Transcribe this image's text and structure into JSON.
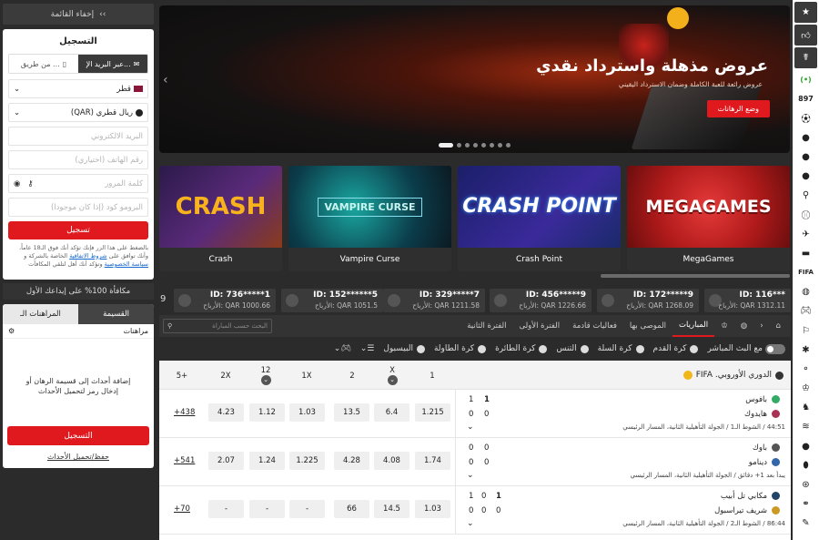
{
  "sidebar": {
    "collapse_label": "إخفاء القائمة",
    "register": {
      "title": "التسجيل",
      "method_email": "عبر البريد الإ...",
      "method_phone": "من طريق ...",
      "country": "قطر",
      "currency": "ريال قطري (QAR)",
      "email_placeholder": "البريد الالكتروني",
      "phone_placeholder": "رقم الهاتف (اختياري)",
      "password_placeholder": "كلمة المرور",
      "promo_placeholder": "البرومو كود (إذا كان موجودا)",
      "submit": "تسجيل",
      "terms_text": "بالضغط على هذا الزر فإنك تؤكد أنك فوق الـ18 عاماً، وأنك توافق على",
      "terms_link1": "شروط الاتفاقية",
      "terms_mid": "الخاصة بالشركة و",
      "terms_link2": "سياسة الخصوصية",
      "terms_end": "وتؤكد أنك أهل لتلقي المكافآت"
    },
    "bonus_text": "مكافأة 100% على إيداعك الأول",
    "betslip": {
      "tab_slip": "القسيمة",
      "tab_bets": "المراهنات الـ",
      "sub_title": "مراهنات",
      "empty_msg": "إضافة أحداث إلى قسيمة الرهان أو إدخال رمز لتحميل الأحداث",
      "register_btn": "التسجيل",
      "save_link": "حفظ/تحميل الأحداث"
    }
  },
  "banner": {
    "title": "عروض مذهلة واسترداد نقدي",
    "subtitle": "عروض رائعة للعبة الكاملة وضمان الاسترداد اليقيني",
    "button": "وضع الرهانات"
  },
  "games": [
    {
      "name": "Crash",
      "art": "CRASH"
    },
    {
      "name": "Vampire Curse",
      "art": "VAMPIRE CURSE"
    },
    {
      "name": "Crash Point",
      "art": "CRASH POINT"
    },
    {
      "name": "MegaGames",
      "art": "MEGAGAMES"
    }
  ],
  "winners_lead": "9",
  "winners": [
    {
      "id": "ID: 736*****1",
      "amount": "الأرباح: QAR 1000.66"
    },
    {
      "id": "ID: 152******5",
      "amount": "الأرباح: QAR 1051.5"
    },
    {
      "id": "ID: 329*****7",
      "amount": "الأرباح: QAR 1211.58"
    },
    {
      "id": "ID: 456*****9",
      "amount": "الأرباح: QAR 1226.66"
    },
    {
      "id": "ID: 172*****9",
      "amount": "الأرباح: QAR 1268.09"
    },
    {
      "id": "ID: 116***",
      "amount": "الأرباح: QAR 1312.11"
    }
  ],
  "nav_tabs": [
    "المباريات",
    "الموصى بها",
    "فعاليات قادمة",
    "الفترة الأولى",
    "الفترة الثانية"
  ],
  "search_placeholder": "البحث حسب المباراة",
  "sports": [
    "مع البث المباشر",
    "كرة القدم",
    "كرة السلة",
    "التنس",
    "كرة الطائرة",
    "كرة الطاولة",
    "البيسبول"
  ],
  "table": {
    "league": "الدوري الأوروبي. FIFA",
    "headers": [
      "1",
      "X",
      "2",
      "1X",
      "12",
      "2X",
      "5+"
    ],
    "rows": [
      {
        "team1": "بافوس",
        "team2": "هايدوك",
        "score1": [
          "1",
          "1"
        ],
        "score2": [
          "0",
          "0"
        ],
        "meta": "44:51 / الشوط الـ1 / الجولة التأهيلية الثانية، المسار الرئيسي",
        "odds": [
          "1.215",
          "6.4",
          "13.5",
          "1.03",
          "1.12",
          "4.23"
        ],
        "more": "+438"
      },
      {
        "team1": "باوك",
        "team2": "دينامو",
        "score1": [
          "0",
          "0"
        ],
        "score2": [
          "0",
          "0"
        ],
        "meta": "يبدأ بعد 1+ دقائق / الجولة التأهيلية الثانية، المسار الرئيسي",
        "odds": [
          "1.74",
          "4.08",
          "4.28",
          "1.225",
          "1.24",
          "2.07"
        ],
        "more": "+541"
      },
      {
        "team1": "مكابي تل أبيب",
        "team2": "شريف تيراسبول",
        "score1": [
          "1",
          "0",
          "1"
        ],
        "score2": [
          "0",
          "0",
          "0"
        ],
        "meta": "86:44 / الشوط الـ2 / الجولة التأهيلية الثانية، المسار الرئيسي",
        "odds": [
          "1.03",
          "14.5",
          "66",
          "-",
          "-",
          "-"
        ],
        "more": "+70"
      }
    ]
  },
  "rightbar": {
    "live_label": "(•)",
    "count": "897"
  }
}
